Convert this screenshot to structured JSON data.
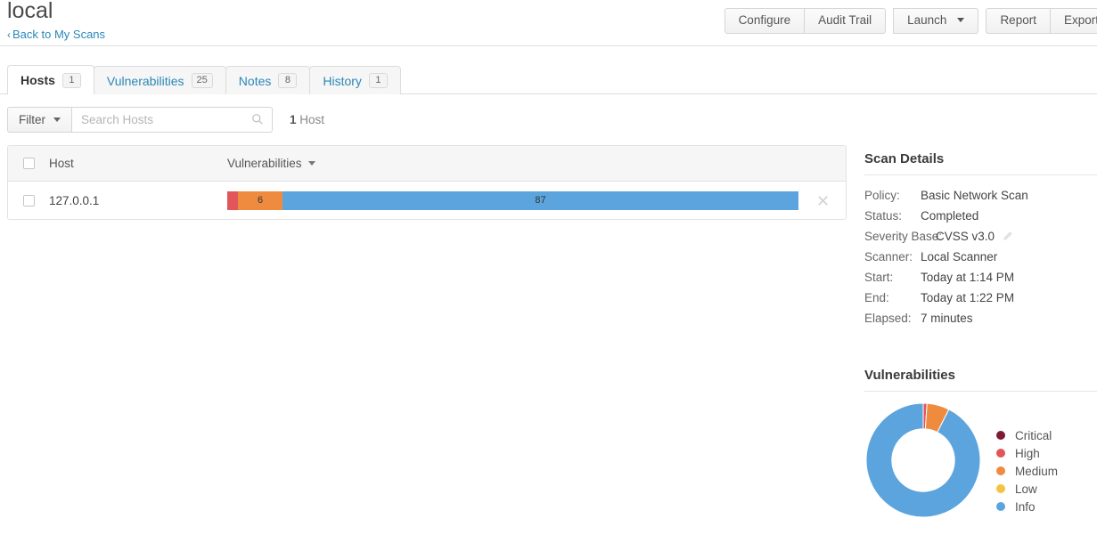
{
  "header": {
    "title": "local",
    "back_link": "Back to My Scans",
    "back_chevron": "‹",
    "buttons": [
      {
        "label": "Configure",
        "name": "configure-button"
      },
      {
        "label": "Audit Trail",
        "name": "audit-trail-button"
      }
    ],
    "launch": {
      "label": "Launch",
      "caret_icon": "chevron-down-icon"
    },
    "report": {
      "label": "Report"
    },
    "export": {
      "label": "Export"
    }
  },
  "tabs": [
    {
      "label": "Hosts",
      "count": "1",
      "active": true
    },
    {
      "label": "Vulnerabilities",
      "count": "25",
      "active": false
    },
    {
      "label": "Notes",
      "count": "8",
      "active": false
    },
    {
      "label": "History",
      "count": "1",
      "active": false
    }
  ],
  "filterbar": {
    "filter_label": "Filter",
    "search_placeholder": "Search Hosts",
    "search_value": "",
    "search_icon": "search-icon",
    "count_number": "1",
    "count_label": "Host"
  },
  "hosts_table": {
    "columns": {
      "host": "Host",
      "vulnerabilities": "Vulnerabilities"
    },
    "sort_icon": "caret-down-icon",
    "rows": [
      {
        "host": "127.0.0.1",
        "remove_icon": "close-icon",
        "severity": [
          {
            "level": "High",
            "count": 1,
            "label": "",
            "color": "#e2555b"
          },
          {
            "level": "Medium",
            "count": 6,
            "label": "6",
            "color": "#ef8b3f"
          },
          {
            "level": "Info",
            "count": 87,
            "label": "87",
            "color": "#5ba4dd"
          }
        ]
      }
    ]
  },
  "scan_details": {
    "title": "Scan Details",
    "rows": [
      {
        "label": "Policy:",
        "value": "Basic Network Scan"
      },
      {
        "label": "Status:",
        "value": "Completed"
      },
      {
        "label": "Severity Base:",
        "value": "CVSS v3.0",
        "edit_icon": "pencil-icon"
      },
      {
        "label": "Scanner:",
        "value": "Local Scanner"
      },
      {
        "label": "Start:",
        "value": "Today at 1:14 PM"
      },
      {
        "label": "End:",
        "value": "Today at 1:22 PM"
      },
      {
        "label": "Elapsed:",
        "value": "7 minutes"
      }
    ]
  },
  "vulnerabilities_panel": {
    "title": "Vulnerabilities"
  },
  "chart_data": {
    "type": "pie",
    "title": "Vulnerabilities",
    "categories": [
      "Critical",
      "High",
      "Medium",
      "Low",
      "Info"
    ],
    "values": [
      0,
      1,
      6,
      0,
      87
    ],
    "colors": [
      "#7d1b33",
      "#e2555b",
      "#ef8b3f",
      "#f5c242",
      "#5ba4dd"
    ],
    "total": 94,
    "legend_position": "right",
    "donut": true,
    "inner_radius_ratio": 0.55,
    "start_angle": 0
  }
}
